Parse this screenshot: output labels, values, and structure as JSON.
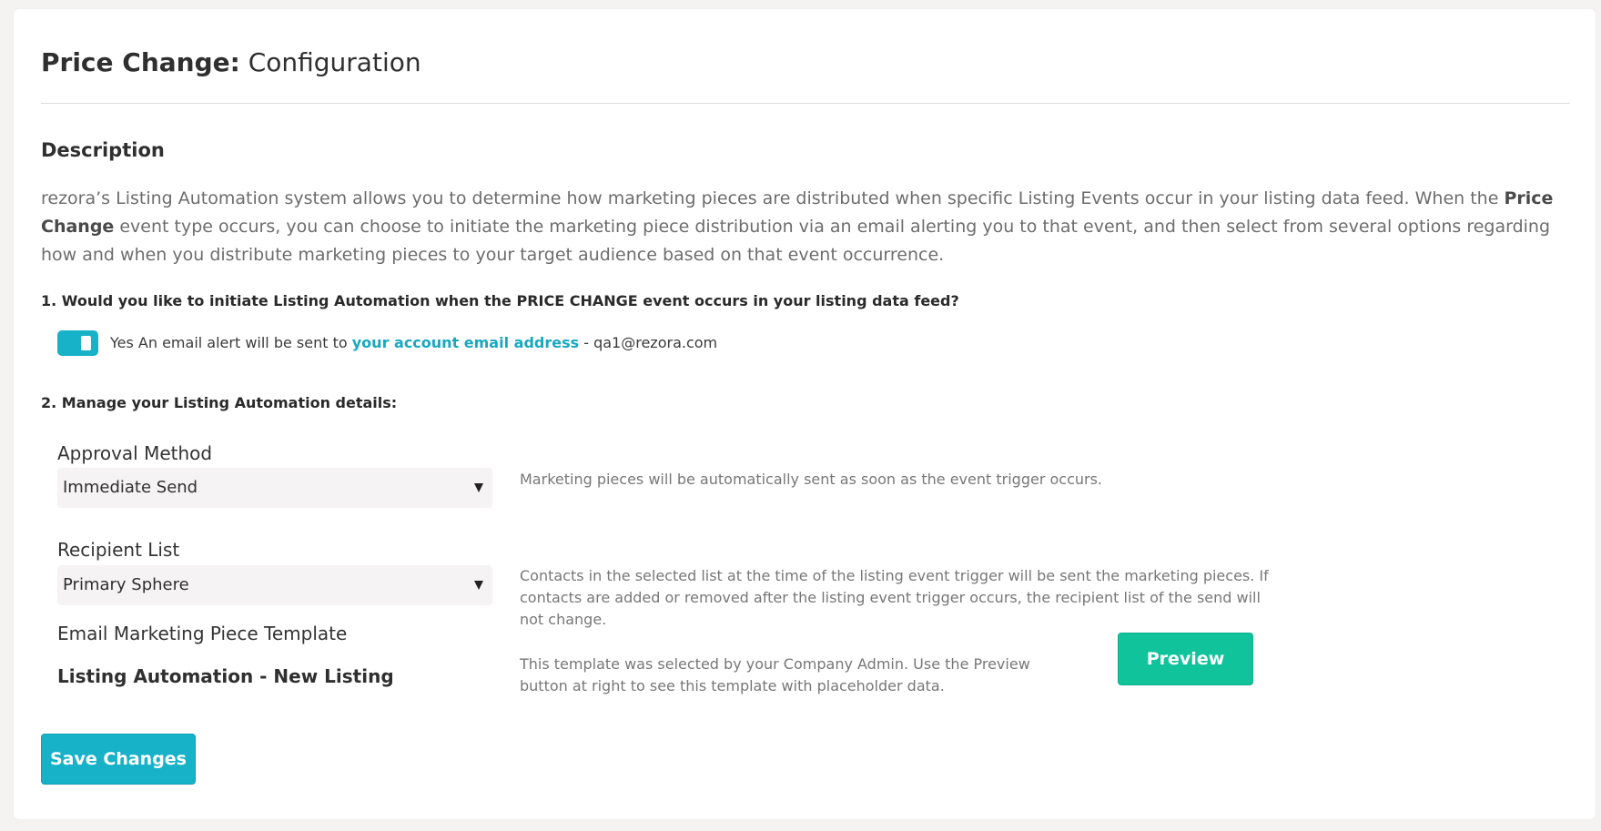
{
  "header": {
    "title_bold": "Price Change:",
    "title_rest": " Configuration"
  },
  "description": {
    "heading": "Description",
    "text_1": "rezora’s Listing Automation system allows you to determine how marketing pieces are distributed when specific Listing Events occur in your listing data feed. When the ",
    "event_name": "Price Change",
    "text_2": " event type occurs, you can choose to initiate the marketing piece distribution via an email alerting you to that event, and then select from several options regarding how and when you distribute marketing pieces to your target audience based on that event occurrence."
  },
  "question_1": {
    "label": "1. Would you like to initiate Listing Automation when the PRICE CHANGE event occurs in your listing data feed?",
    "toggle_on": true,
    "answer": "Yes",
    "alert_text": " An email alert will be sent to ",
    "link_text": "your account email address",
    "email_suffix": " - qa1@rezora.com"
  },
  "question_2": {
    "label": "2. Manage your Listing Automation details:"
  },
  "approval_method": {
    "label": "Approval Method",
    "selected": "Immediate Send",
    "help": "Marketing pieces will be automatically sent as soon as the event trigger occurs."
  },
  "recipient_list": {
    "label": "Recipient List",
    "selected": "Primary Sphere",
    "help": "Contacts in the selected list at the time of the listing event trigger will be sent the marketing pieces. If contacts are added or removed after the listing event trigger occurs, the recipient list of the send will not change."
  },
  "template": {
    "label": "Email Marketing Piece Template",
    "name": "Listing Automation - New Listing",
    "help": "This template was selected by your Company Admin. Use the Preview button at right to see this template with placeholder data.",
    "preview_label": "Preview"
  },
  "actions": {
    "save_label": "Save Changes"
  },
  "colors": {
    "accent": "#17b2c8",
    "preview_green": "#11c39b",
    "link": "#17a8c0"
  },
  "icons": {
    "toggle": "toggle-switch",
    "dropdown": "chevron-down-icon"
  }
}
